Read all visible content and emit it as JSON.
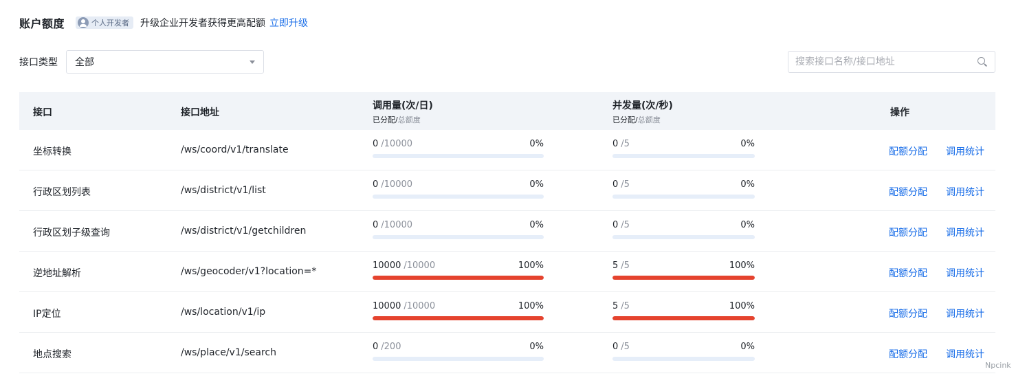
{
  "header": {
    "title": "账户额度",
    "badge": "个人开发者",
    "upgrade_text": "升级企业开发者获得更高配额",
    "upgrade_link": "立即升级"
  },
  "filter": {
    "label": "接口类型",
    "selected": "全部"
  },
  "search": {
    "placeholder": "搜索接口名称/接口地址"
  },
  "table": {
    "columns": {
      "name": "接口",
      "address": "接口地址",
      "daily": "调用量(次/日)",
      "daily_sub_allocated": "已分配",
      "daily_sub_sep": "/",
      "daily_sub_total": "总额度",
      "qps": "并发量(次/秒)",
      "qps_sub_allocated": "已分配",
      "qps_sub_sep": "/",
      "qps_sub_total": "总额度",
      "actions": "操作"
    },
    "rows": [
      {
        "name": "坐标转换",
        "address": "/ws/coord/v1/translate",
        "daily_used": "0",
        "daily_total": "/10000",
        "daily_pct": "0%",
        "daily_ratio": 0,
        "qps_used": "0",
        "qps_total": "/5",
        "qps_pct": "0%",
        "qps_ratio": 0,
        "action1": "配额分配",
        "action2": "调用统计"
      },
      {
        "name": "行政区划列表",
        "address": "/ws/district/v1/list",
        "daily_used": "0",
        "daily_total": "/10000",
        "daily_pct": "0%",
        "daily_ratio": 0,
        "qps_used": "0",
        "qps_total": "/5",
        "qps_pct": "0%",
        "qps_ratio": 0,
        "action1": "配额分配",
        "action2": "调用统计"
      },
      {
        "name": "行政区划子级查询",
        "address": "/ws/district/v1/getchildren",
        "daily_used": "0",
        "daily_total": "/10000",
        "daily_pct": "0%",
        "daily_ratio": 0,
        "qps_used": "0",
        "qps_total": "/5",
        "qps_pct": "0%",
        "qps_ratio": 0,
        "action1": "配额分配",
        "action2": "调用统计"
      },
      {
        "name": "逆地址解析",
        "address": "/ws/geocoder/v1?location=*",
        "daily_used": "10000",
        "daily_total": "/10000",
        "daily_pct": "100%",
        "daily_ratio": 1,
        "qps_used": "5",
        "qps_total": "/5",
        "qps_pct": "100%",
        "qps_ratio": 1,
        "action1": "配额分配",
        "action2": "调用统计"
      },
      {
        "name": "IP定位",
        "address": "/ws/location/v1/ip",
        "daily_used": "10000",
        "daily_total": "/10000",
        "daily_pct": "100%",
        "daily_ratio": 1,
        "qps_used": "5",
        "qps_total": "/5",
        "qps_pct": "100%",
        "qps_ratio": 1,
        "action1": "配额分配",
        "action2": "调用统计"
      },
      {
        "name": "地点搜索",
        "address": "/ws/place/v1/search",
        "daily_used": "0",
        "daily_total": "/200",
        "daily_pct": "0%",
        "daily_ratio": 0,
        "qps_used": "0",
        "qps_total": "/5",
        "qps_pct": "0%",
        "qps_ratio": 0,
        "action1": "配额分配",
        "action2": "调用统计"
      }
    ]
  },
  "colors": {
    "accent": "#1a6ee8",
    "bar_full": "#e5432e",
    "bar_track": "#e6eef9",
    "header_bg": "#f1f4f8"
  },
  "watermark": "Npcink"
}
